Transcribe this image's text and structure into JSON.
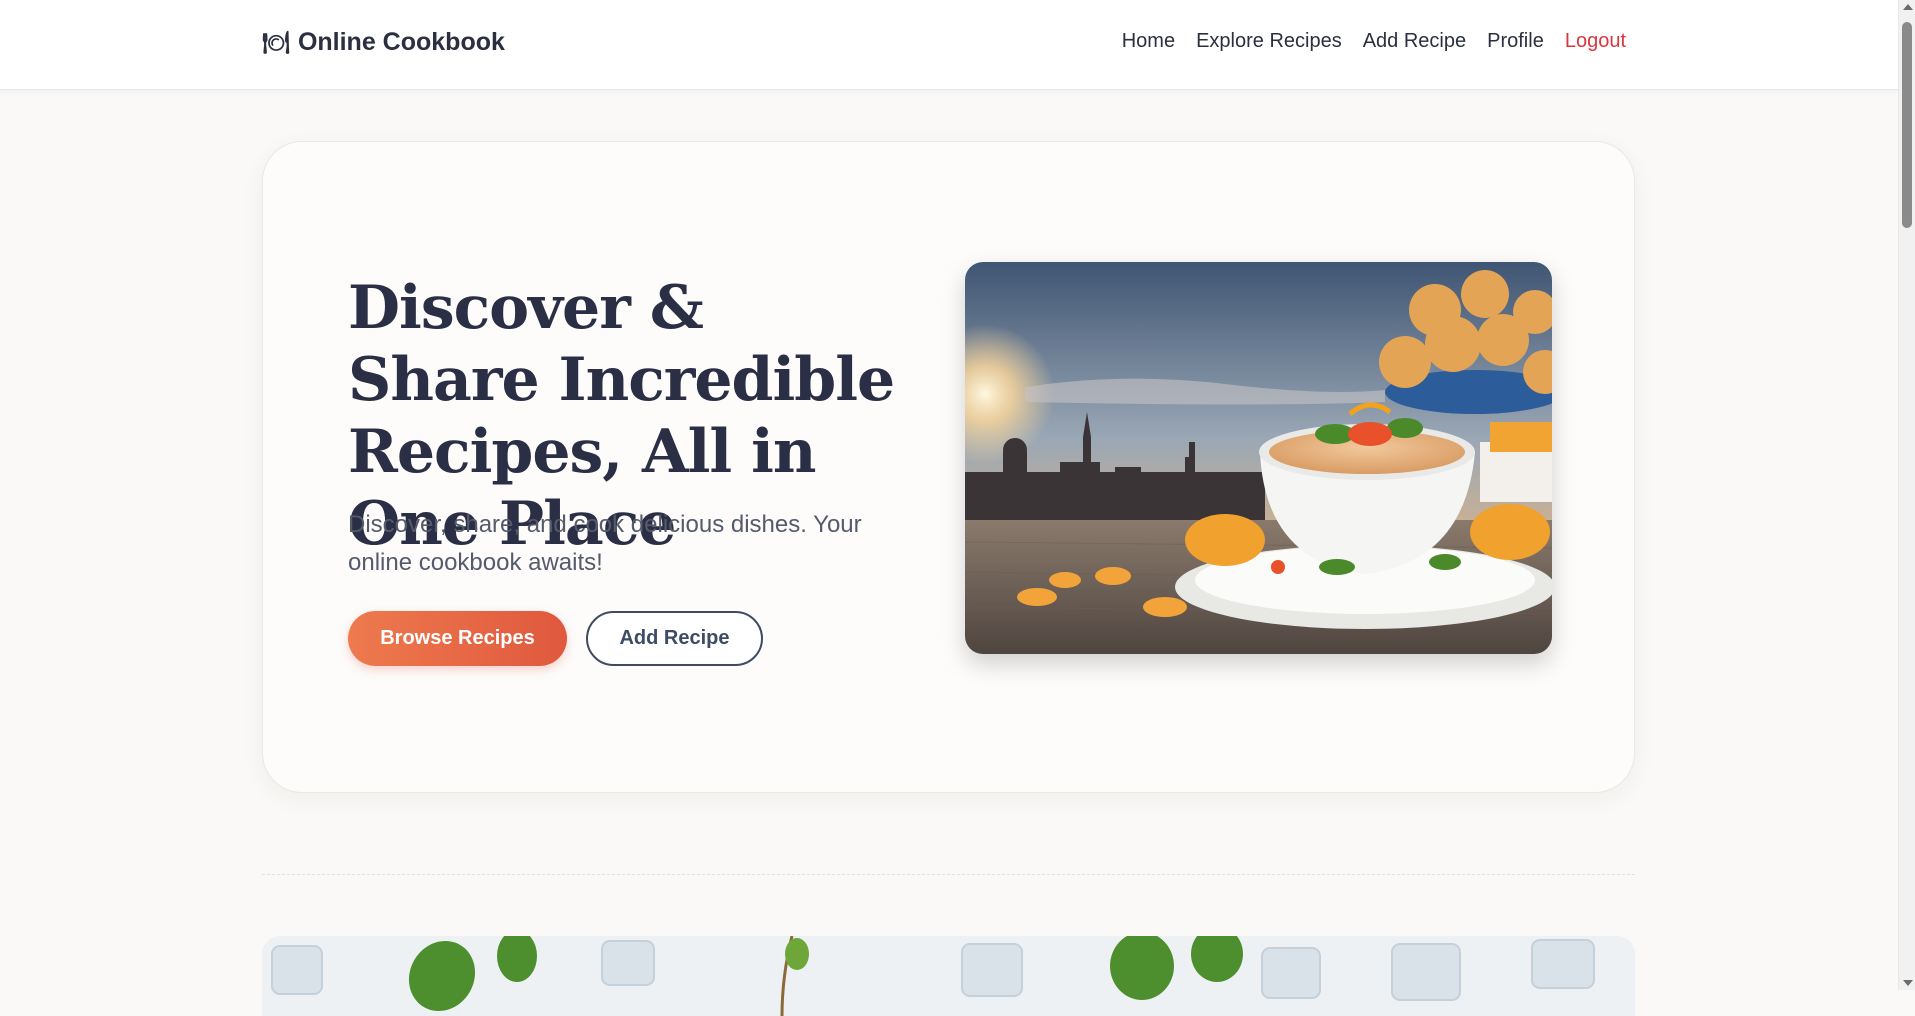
{
  "navbar": {
    "brand_icon": "🍽",
    "brand_name": "Online Cookbook",
    "links": [
      {
        "label": "Home"
      },
      {
        "label": "Explore Recipes"
      },
      {
        "label": "Add Recipe"
      },
      {
        "label": "Profile"
      },
      {
        "label": "Logout"
      }
    ]
  },
  "hero": {
    "title": "Discover & Share Incredible Recipes, All in One Place",
    "subtitle": "Discover, share, and cook delicious dishes. Your online cookbook awaits!",
    "primary_button": "Browse Recipes",
    "secondary_button": "Add Recipe",
    "image_icon": "food-bowl-image"
  },
  "colors": {
    "accent": "#e8663f",
    "danger": "#d9363e",
    "text": "#2b2f45",
    "background": "#faf9f7"
  }
}
